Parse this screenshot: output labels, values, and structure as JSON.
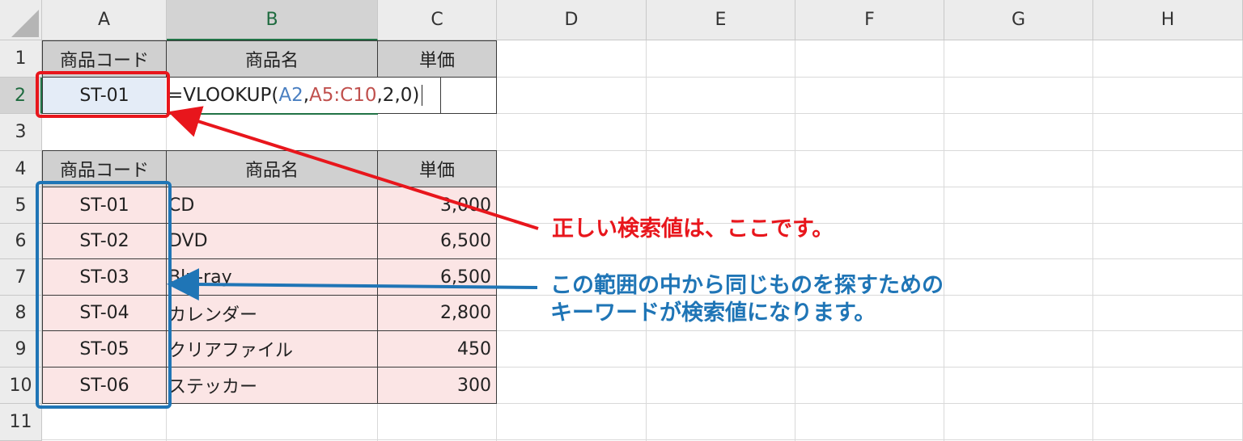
{
  "columns": [
    "A",
    "B",
    "C",
    "D",
    "E",
    "F",
    "G",
    "H"
  ],
  "rows": [
    "1",
    "2",
    "3",
    "4",
    "5",
    "6",
    "7",
    "8",
    "9",
    "10",
    "11"
  ],
  "header_row_1": {
    "a": "商品コード",
    "b": "商品名",
    "c": "単価"
  },
  "lookup_cell": "ST-01",
  "formula": {
    "prefix": "=VLOOKUP(",
    "ref1": "A2",
    "comma1": ",",
    "ref2": "A5:C10",
    "suffix": ",2,0)"
  },
  "header_row_4": {
    "a": "商品コード",
    "b": "商品名",
    "c": "単価"
  },
  "table": [
    {
      "code": "ST-01",
      "name": "CD",
      "price": "3,000"
    },
    {
      "code": "ST-02",
      "name": "DVD",
      "price": "6,500"
    },
    {
      "code": "ST-03",
      "name": "Blu-ray",
      "price": "6,500"
    },
    {
      "code": "ST-04",
      "name": "カレンダー",
      "price": "2,800"
    },
    {
      "code": "ST-05",
      "name": "クリアファイル",
      "price": "450"
    },
    {
      "code": "ST-06",
      "name": "ステッカー",
      "price": "300"
    }
  ],
  "annotations": {
    "red_note": "正しい検索値は、ここです。",
    "blue_note_line1": "この範囲の中から同じものを探すための",
    "blue_note_line2": "キーワードが検索値になります。"
  },
  "colors": {
    "red": "#e8161c",
    "blue": "#1f75b6",
    "green": "#217346",
    "pink": "#fbe5e5"
  }
}
